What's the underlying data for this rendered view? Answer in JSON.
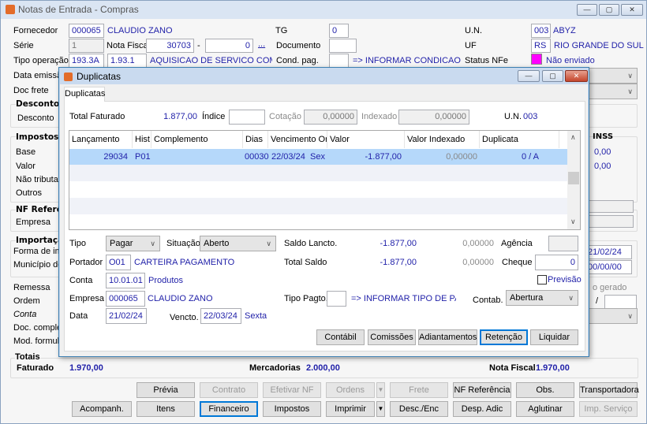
{
  "window": {
    "title": "Notas de Entrada - Compras",
    "buttons": {
      "minimize": "—",
      "maximize": "▢",
      "close": "✕"
    }
  },
  "header": {
    "fornecedor_label": "Fornecedor",
    "fornecedor_code": "000065",
    "fornecedor_name": "CLAUDIO ZANO",
    "tg_label": "TG",
    "tg_value": "0",
    "un_label": "U.N.",
    "un_code": "003",
    "un_name": "ABYZ",
    "serie_label": "Série",
    "serie_value": "1",
    "nota_fiscal_label": "Nota Fiscal",
    "nota_fiscal_value": "30703",
    "dash": "-",
    "nota_fiscal_suffix": "0",
    "ellipsis": "...",
    "documento_label": "Documento",
    "documento_value": "",
    "uf_label": "UF",
    "uf_code": "RS",
    "uf_name": "RIO GRANDE DO SUL",
    "tipo_operacao_label": "Tipo operação",
    "tipo_operacao_code": "193.3A",
    "cfop": "1.93.1",
    "tipo_operacao_desc": "AQUISICAO DE SERVICO COM RETEI",
    "cond_pag_label": "Cond. pag.",
    "cond_pag_value": "",
    "cond_pag_hint": "=> INFORMAR CONDICAO DE PA",
    "status_nfe_label": "Status NFe",
    "status_nfe_color": "#ff00ff",
    "status_nfe_value": "Não enviado",
    "data_emissao_label": "Data emissão",
    "doc_frete_label": "Doc frete"
  },
  "left": {
    "descontos_title": "Descontos,",
    "desconto_label": "Desconto",
    "impostos_title": "Impostos",
    "base_label": "Base",
    "valor_label": "Valor",
    "nao_tributado_label": "Não tributad",
    "outros_label": "Outros",
    "nf_referencia_title": "NF Referên",
    "empresa_label": "Empresa",
    "importacao_title": "Importaçã",
    "forma_label": "Forma de imp",
    "municipio_label": "Município des",
    "remessa_label": "Remessa",
    "ordem_label": "Ordem",
    "conta_label": "Conta",
    "doc_completo_label": "Doc. complet",
    "mod_formulario_label": "Mod. formulár"
  },
  "right": {
    "inss_label": "INSS",
    "inss_base": "0,00",
    "inss_valor": "0,00",
    "date1": "21/02/24",
    "date2": "00/00/00",
    "gerado_label": "o gerado",
    "slash": "/"
  },
  "totais": {
    "title": "Totais",
    "faturado_label": "Faturado",
    "faturado_value": "1.970,00",
    "mercadorias_label": "Mercadorias",
    "mercadorias_value": "2.000,00",
    "nota_fiscal_label": "Nota Fiscal",
    "nota_fiscal_value": "1.970,00"
  },
  "buttons_row1": [
    "Prévia",
    "Contrato",
    "Efetivar NF",
    "Ordens",
    "Frete",
    "NF Referência",
    "Obs.",
    "Transportadora"
  ],
  "buttons_row2": [
    "Acompanh.",
    "Itens",
    "Financeiro",
    "Impostos",
    "Imprimir",
    "Desc./Enc",
    "Desp. Adic",
    "Aglutinar",
    "Imp. Serviço"
  ],
  "dialog": {
    "title": "Duplicatas",
    "tab": "Duplicatas",
    "total_faturado_label": "Total Faturado",
    "total_faturado_value": "1.877,00",
    "indice_label": "Índice",
    "indice_value": "",
    "cotacao_label": "Cotação",
    "cotacao_value": "0,00000",
    "indexado_label": "Indexado",
    "indexado_value": "0,00000",
    "un_label": "U.N.",
    "un_value": "003",
    "grid": {
      "columns": [
        "Lançamento",
        "Hist.",
        "Complemento",
        "Dias",
        "Vencimento Orig.",
        "Valor",
        "Valor Indexado",
        "Duplicata"
      ],
      "rows": [
        {
          "lancamento": "29034",
          "hist": "P01",
          "complemento": "",
          "dias": "00030",
          "vencimento": "22/03/24",
          "dia_semana": "Sex",
          "valor": "-1.877,00",
          "valor_indexado": "0,00000",
          "duplicata": "0 / A"
        }
      ]
    },
    "tipo_label": "Tipo",
    "tipo_value": "Pagar",
    "situacao_label": "Situação",
    "situacao_value": "Aberto",
    "saldo_lancto_label": "Saldo Lancto.",
    "saldo_lancto_value": "-1.877,00",
    "saldo_lancto_indexado": "0,00000",
    "agencia_label": "Agência",
    "agencia_value": "",
    "portador_label": "Portador",
    "portador_code": "O01",
    "portador_name": "CARTEIRA PAGAMENTO",
    "total_saldo_label": "Total Saldo",
    "total_saldo_value": "-1.877,00",
    "total_saldo_indexado": "0,00000",
    "cheque_label": "Cheque",
    "cheque_value": "0",
    "conta_label": "Conta",
    "conta_code": "10.01.01",
    "conta_name": "Produtos",
    "previsao_label": "Previsão",
    "previsao_checked": false,
    "empresa_label": "Empresa",
    "empresa_code": "000065",
    "empresa_name": "CLAUDIO ZANO",
    "tipo_pagto_label": "Tipo Pagto.",
    "tipo_pagto_value": "",
    "tipo_pagto_hint": "=> INFORMAR TIPO DE PAGAM",
    "contab_label": "Contab.",
    "contab_value": "Abertura",
    "data_label": "Data",
    "data_value": "21/02/24",
    "vencto_label": "Vencto.",
    "vencto_value": "22/03/24",
    "vencto_dia": "Sexta",
    "buttons": [
      "Contábil",
      "Comissões",
      "Adiantamentos",
      "Retenção",
      "Liquidar"
    ]
  }
}
